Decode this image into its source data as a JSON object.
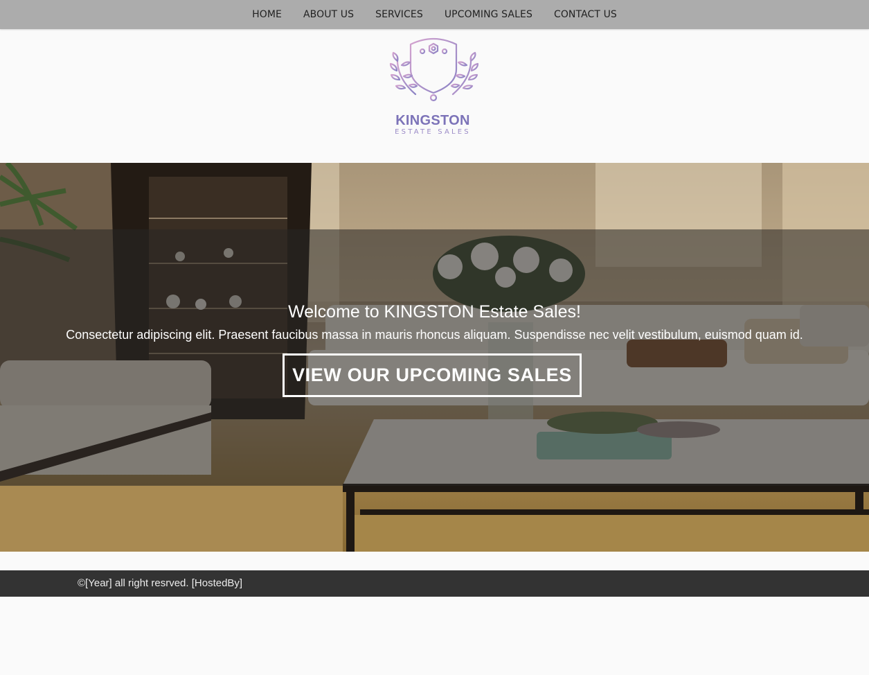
{
  "nav": {
    "items": [
      {
        "label": "HOME"
      },
      {
        "label": "ABOUT US"
      },
      {
        "label": "SERVICES"
      },
      {
        "label": "UPCOMING SALES"
      },
      {
        "label": "CONTACT US"
      }
    ]
  },
  "logo": {
    "name": "KINGSTON",
    "tagline": "ESTATE SALES",
    "icon": "crest-with-laurel-icon",
    "colors": {
      "primary": "#7c73b8",
      "accent": "#c7a0d4"
    }
  },
  "hero": {
    "background": "living-room-photo",
    "title": "Welcome to KINGSTON Estate Sales!",
    "text": "Consectetur adipiscing elit. Praesent faucibus massa in mauris rhoncus aliquam. Suspendisse nec velit vestibulum, euismod quam id.",
    "cta_label": "VIEW OUR UPCOMING SALES"
  },
  "footer": {
    "copyright": "©[Year] all right resrved. [HostedBy]"
  }
}
